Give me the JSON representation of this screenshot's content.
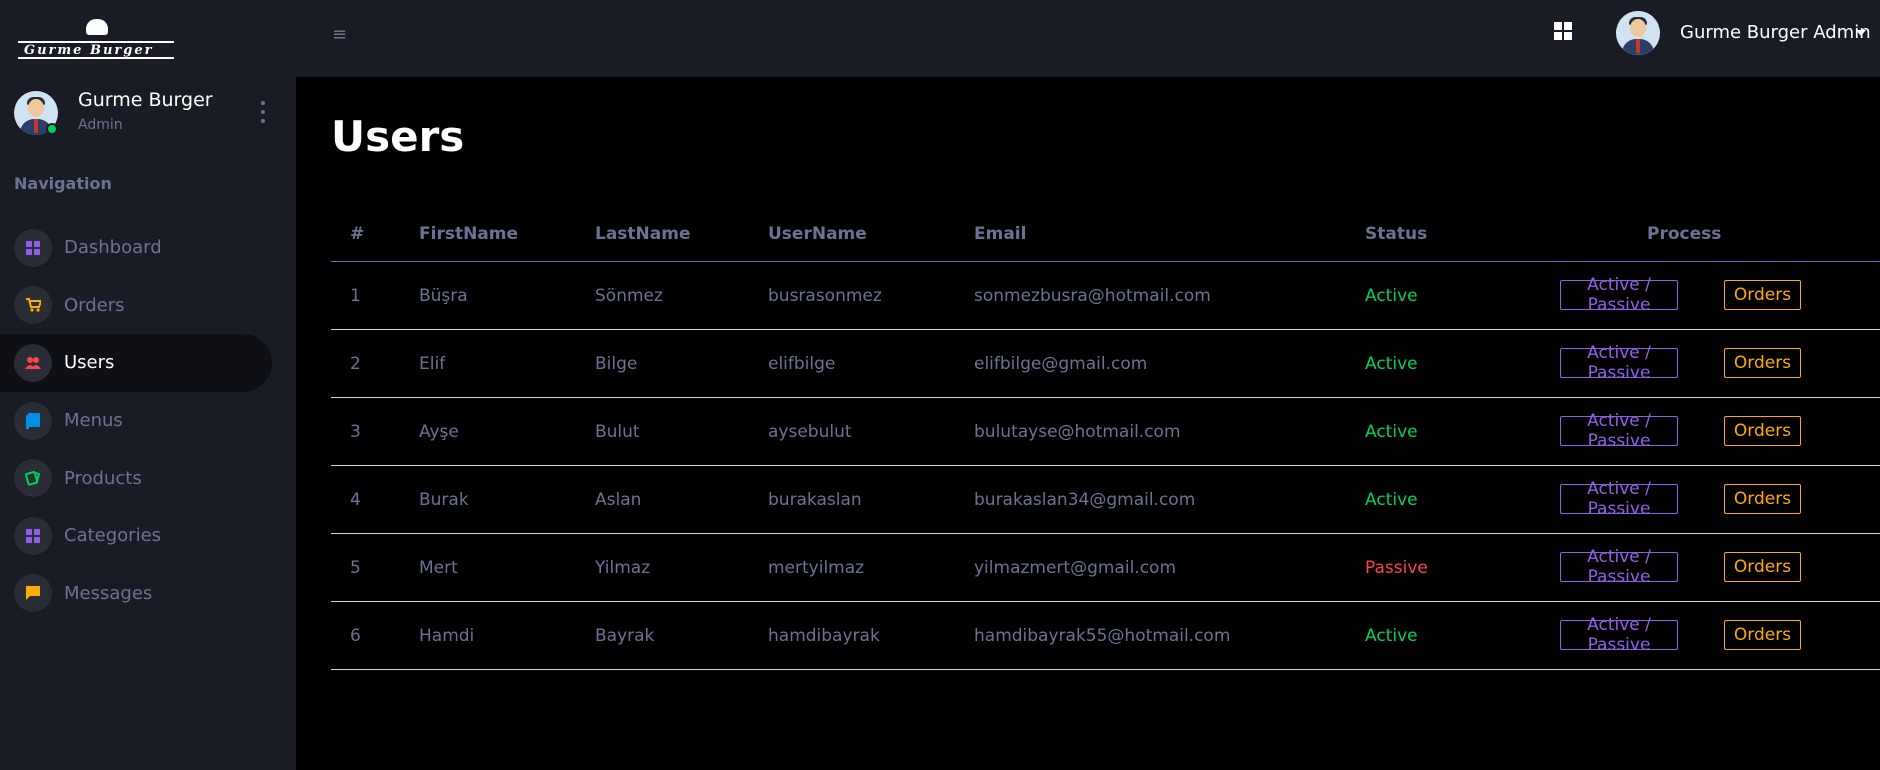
{
  "brand": {
    "logo_text": "Gurme Burger"
  },
  "profile": {
    "name": "Gurme Burger",
    "role": "Admin"
  },
  "nav_heading": "Navigation",
  "nav": [
    {
      "label": "Dashboard",
      "icon": "dashboard-icon",
      "active": false
    },
    {
      "label": "Orders",
      "icon": "cart-icon",
      "active": false
    },
    {
      "label": "Users",
      "icon": "users-icon",
      "active": true
    },
    {
      "label": "Menus",
      "icon": "book-icon",
      "active": false
    },
    {
      "label": "Products",
      "icon": "product-icon",
      "active": false
    },
    {
      "label": "Categories",
      "icon": "grid-icon",
      "active": false
    },
    {
      "label": "Messages",
      "icon": "message-icon",
      "active": false
    }
  ],
  "topbar": {
    "user_name": "Gurme Burger Admin"
  },
  "page": {
    "title": "Users"
  },
  "table": {
    "headers": [
      "#",
      "FirstName",
      "LastName",
      "UserName",
      "Email",
      "Status",
      "Process"
    ],
    "rows": [
      {
        "id": "1",
        "first": "Büşra",
        "last": "Sönmez",
        "username": "busrasonmez",
        "email": "sonmezbusra@hotmail.com",
        "status": "Active"
      },
      {
        "id": "2",
        "first": "Elif",
        "last": "Bilge",
        "username": "elifbilge",
        "email": "elifbilge@gmail.com",
        "status": "Active"
      },
      {
        "id": "3",
        "first": "Ayşe",
        "last": "Bulut",
        "username": "aysebulut",
        "email": "bulutayse@hotmail.com",
        "status": "Active"
      },
      {
        "id": "4",
        "first": "Burak",
        "last": "Aslan",
        "username": "burakaslan",
        "email": "burakaslan34@gmail.com",
        "status": "Active"
      },
      {
        "id": "5",
        "first": "Mert",
        "last": "Yilmaz",
        "username": "mertyilmaz",
        "email": "yilmazmert@gmail.com",
        "status": "Passive"
      },
      {
        "id": "6",
        "first": "Hamdi",
        "last": "Bayrak",
        "username": "hamdibayrak",
        "email": "hamdibayrak55@hotmail.com",
        "status": "Active"
      }
    ],
    "buttons": {
      "toggle_label": "Active / Passive",
      "orders_label": "Orders"
    }
  },
  "colors": {
    "sidebar_bg": "#191c24",
    "main_bg": "#000000",
    "active_status": "#00d25b",
    "passive_status": "#fc424a",
    "primary_outline": "#8f5fe8",
    "warning_outline": "#ffab00"
  }
}
